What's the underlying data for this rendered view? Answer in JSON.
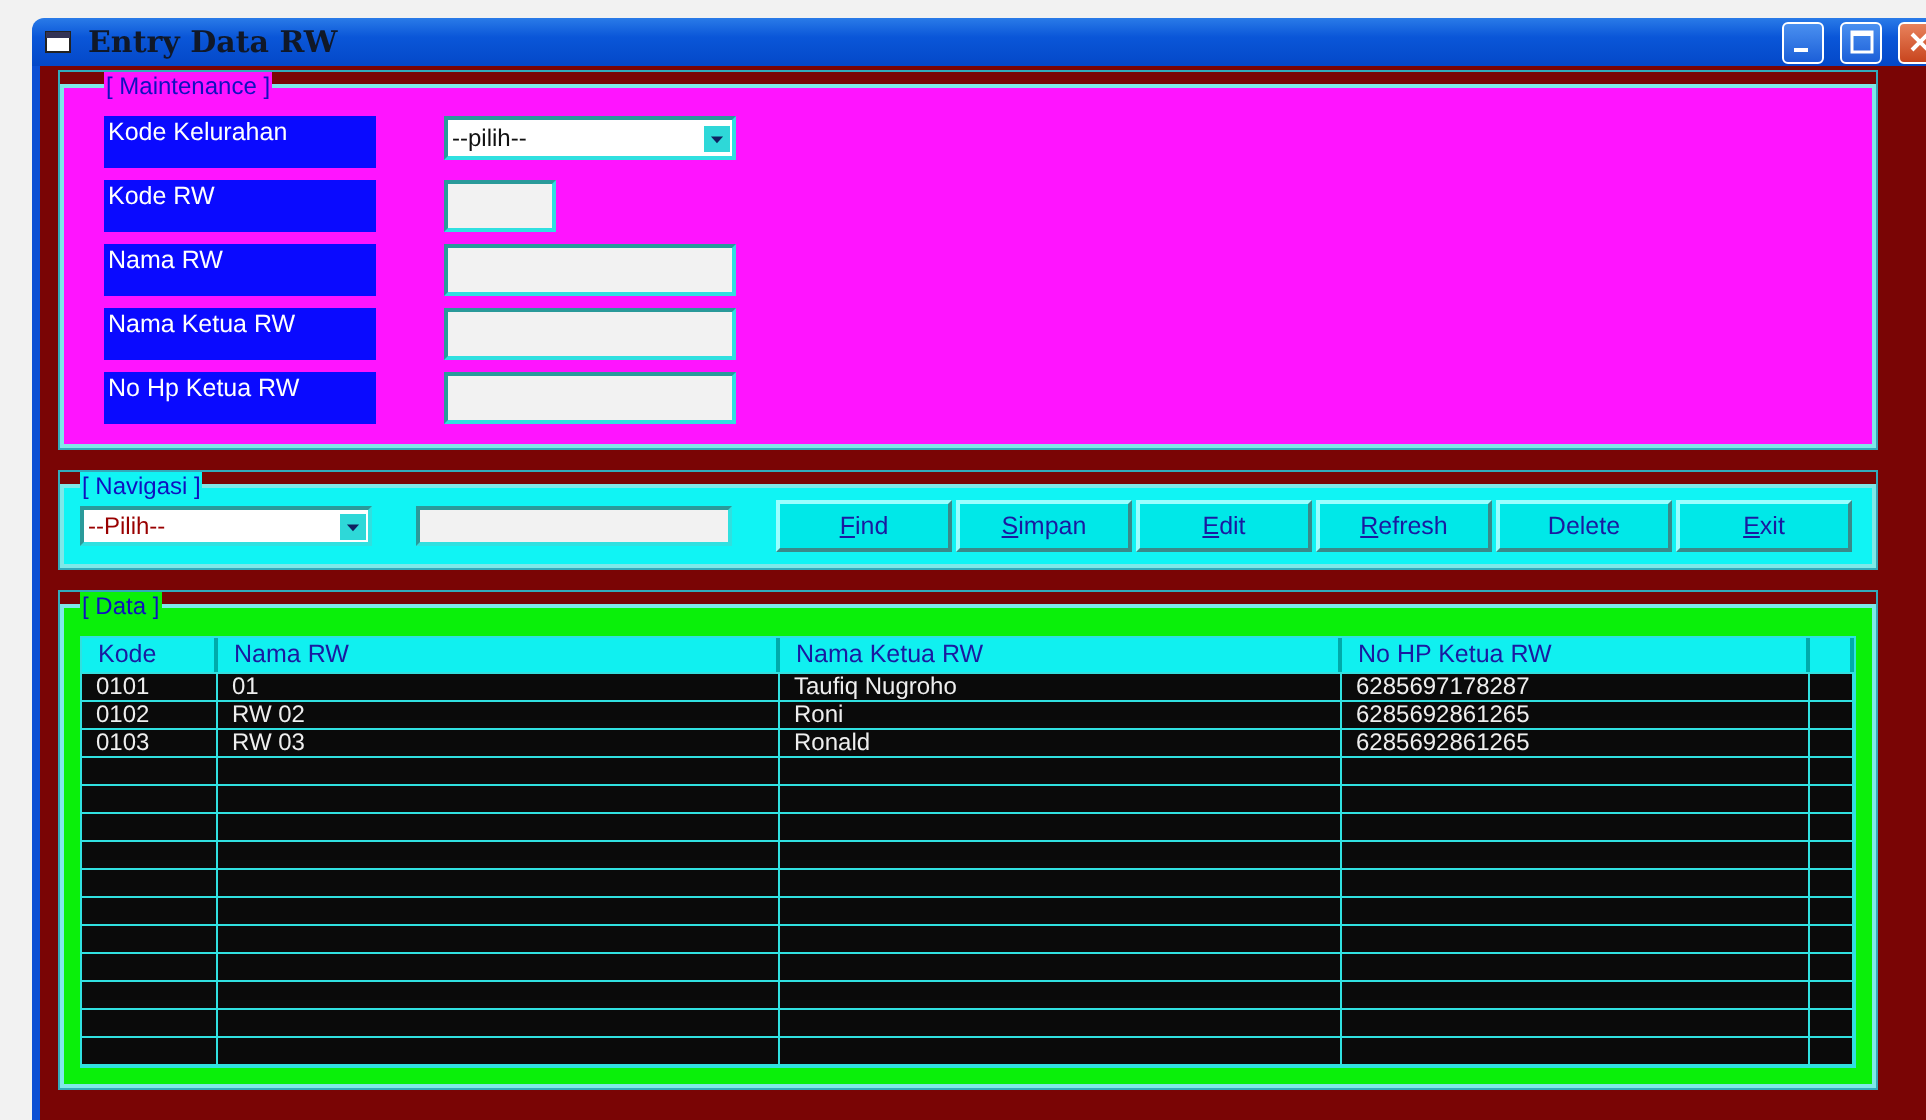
{
  "window": {
    "title": "Entry Data RW"
  },
  "maintenance": {
    "legend": "[ Maintenance ]",
    "fields": [
      {
        "kind": "dropdown",
        "label": "Kode Kelurahan",
        "value": "--pilih--"
      },
      {
        "kind": "short",
        "label": "Kode RW"
      },
      {
        "kind": "text",
        "label": "Nama RW"
      },
      {
        "kind": "text",
        "label": "Nama Ketua RW"
      },
      {
        "kind": "text",
        "label": "No Hp Ketua RW"
      }
    ]
  },
  "navigation": {
    "legend": "[ Navigasi ]",
    "dropdown": {
      "value": "--Pilih--"
    },
    "buttons": [
      {
        "label": "Find",
        "mnemonic": true
      },
      {
        "label": "Simpan",
        "mnemonic": true
      },
      {
        "label": "Edit",
        "mnemonic": true
      },
      {
        "label": "Refresh",
        "mnemonic": true
      },
      {
        "label": "Delete",
        "mnemonic": false
      },
      {
        "label": "Exit",
        "mnemonic": true
      }
    ]
  },
  "data": {
    "legend": "[ Data ]",
    "columns": [
      "Kode",
      "Nama RW",
      "Nama Ketua RW",
      "No HP Ketua RW"
    ],
    "rows": [
      [
        "0101",
        "01",
        "Taufiq Nugroho",
        "6285697178287"
      ],
      [
        "0102",
        "RW 02",
        "Roni",
        "6285692861265"
      ],
      [
        "0103",
        "RW 03",
        "Ronald",
        "6285692861265"
      ]
    ]
  }
}
